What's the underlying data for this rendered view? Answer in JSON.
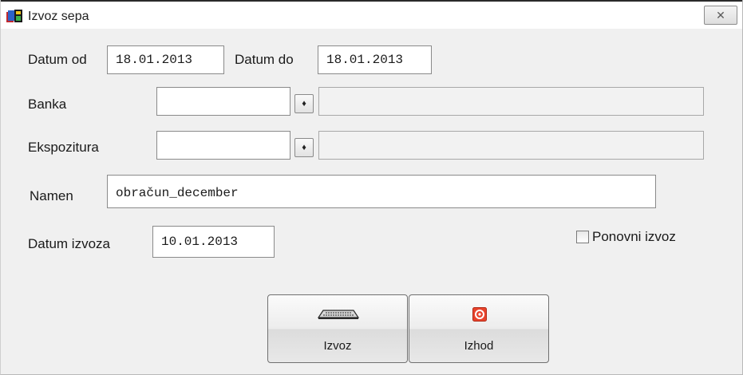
{
  "window": {
    "title": "Izvoz sepa",
    "close_symbol": "✕"
  },
  "icons": {
    "app": "app-icon",
    "close": "close-icon",
    "export": "export-icon",
    "exit": "exit-icon",
    "lookup": "lookup-icon"
  },
  "form": {
    "datum_od": {
      "label": "Datum od",
      "value": "18.01.2013"
    },
    "datum_do": {
      "label": "Datum do",
      "value": "18.01.2013"
    },
    "banka": {
      "label": "Banka",
      "value": "",
      "lookup": "♦",
      "description": ""
    },
    "ekspozitura": {
      "label": "Ekspozitura",
      "value": "",
      "lookup": "♦",
      "description": ""
    },
    "namen": {
      "label": "Namen",
      "value": "obračun_december"
    },
    "datum_izvoza": {
      "label": "Datum izvoza",
      "value": "10.01.2013"
    },
    "ponovni_izvoz": {
      "label": "Ponovni izvoz",
      "checked": false
    }
  },
  "buttons": {
    "izvoz": {
      "label": "Izvoz"
    },
    "izhod": {
      "label": "Izhod"
    }
  }
}
